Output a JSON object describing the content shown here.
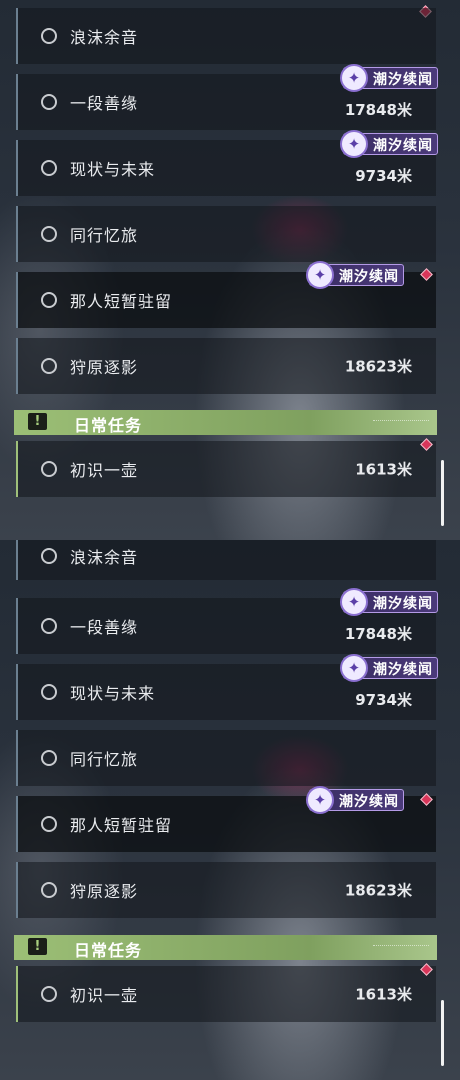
{
  "quest_panels": [
    {
      "quests": [
        {
          "name": "浪沫余音",
          "distance": "",
          "badge": "",
          "tracked": false
        },
        {
          "name": "一段善缘",
          "distance": "17848米",
          "badge": "潮汐续闻",
          "tracked": false
        },
        {
          "name": "现状与未来",
          "distance": "9734米",
          "badge": "潮汐续闻",
          "tracked": false
        },
        {
          "name": "同行忆旅",
          "distance": "",
          "badge": "",
          "tracked": false
        },
        {
          "name": "那人短暂驻留",
          "distance": "",
          "badge": "潮汐续闻",
          "tracked": true
        },
        {
          "name": "狩原逐影",
          "distance": "18623米",
          "badge": "",
          "tracked": false
        }
      ],
      "daily": {
        "title": "日常任务",
        "icon": "!",
        "quest": {
          "name": "初识一壶",
          "distance": "1613米",
          "tracked": true
        }
      }
    },
    {
      "quests": [
        {
          "name": "浪沫余音",
          "distance": "",
          "badge": "",
          "tracked": false
        },
        {
          "name": "一段善缘",
          "distance": "17848米",
          "badge": "潮汐续闻",
          "tracked": false
        },
        {
          "name": "现状与未来",
          "distance": "9734米",
          "badge": "潮汐续闻",
          "tracked": false
        },
        {
          "name": "同行忆旅",
          "distance": "",
          "badge": "",
          "tracked": false
        },
        {
          "name": "那人短暂驻留",
          "distance": "",
          "badge": "潮汐续闻",
          "tracked": true
        },
        {
          "name": "狩原逐影",
          "distance": "18623米",
          "badge": "",
          "tracked": false
        }
      ],
      "daily": {
        "title": "日常任务",
        "icon": "!",
        "quest": {
          "name": "初识一壶",
          "distance": "1613米",
          "tracked": true
        }
      }
    }
  ],
  "icons": {
    "badge_icon": "tide-swirl-icon",
    "tracking_marker": "diamond-marker-icon",
    "quest_status": "radio-circle-icon",
    "daily_header_icon": "exclamation-icon"
  },
  "colors": {
    "badge_bg": "#4b3a7a",
    "badge_border": "#b49ae6",
    "daily_header": "#9cbf76",
    "tracking_marker": "#d9365a",
    "text": "#e9ebee"
  }
}
